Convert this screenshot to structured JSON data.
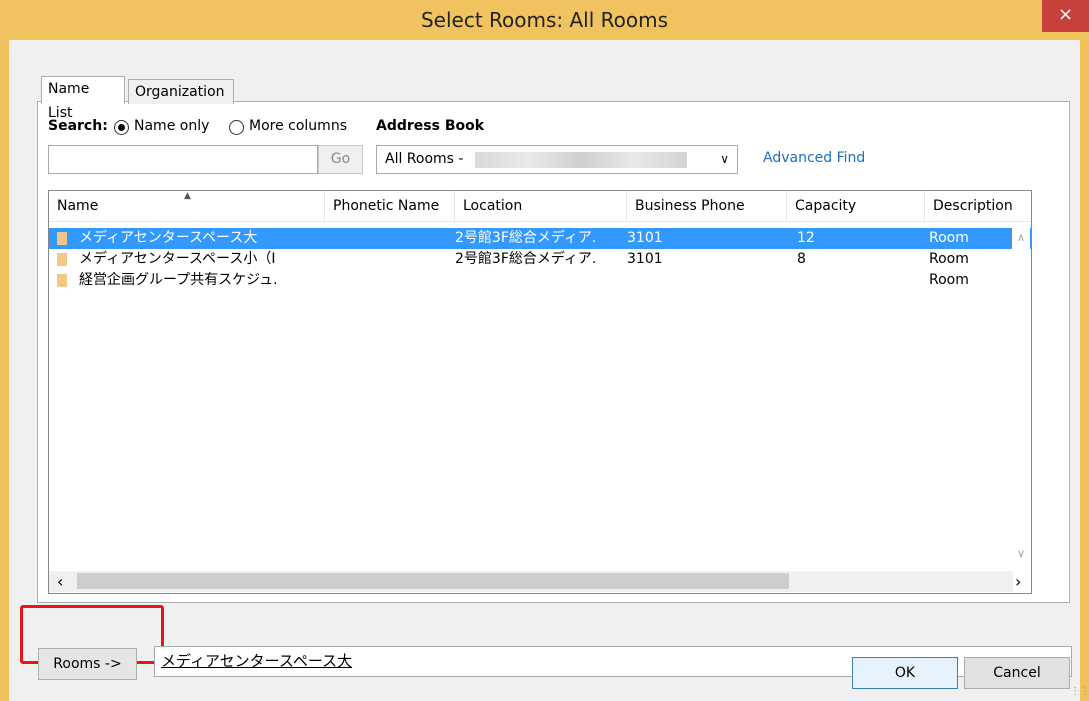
{
  "window": {
    "title": "Select Rooms: All Rooms",
    "close_icon": "×"
  },
  "tabs": [
    {
      "label": "Name List"
    },
    {
      "label": "Organization"
    }
  ],
  "search": {
    "label": "Search:",
    "options": [
      {
        "label": "Name only",
        "selected": true
      },
      {
        "label": "More columns",
        "selected": false
      }
    ],
    "input_value": "",
    "go_label": "Go"
  },
  "address_book": {
    "label": "Address Book",
    "selected": "All Rooms -",
    "advanced_find": "Advanced Find"
  },
  "list": {
    "columns": [
      "Name",
      "Phonetic Name",
      "Location",
      "Business Phone",
      "Capacity",
      "Description"
    ],
    "rows": [
      {
        "name": "メディアセンタースペース大",
        "phonetic": "",
        "location": "2号館3F総合メディア.",
        "phone": "3101",
        "capacity": "12",
        "description": "Room",
        "selected": true
      },
      {
        "name": "メディアセンタースペース小（I",
        "phonetic": "",
        "location": "2号館3F総合メディア.",
        "phone": "3101",
        "capacity": "8",
        "description": "Room",
        "selected": false
      },
      {
        "name": "経営企画グループ共有スケジュ.",
        "phonetic": "",
        "location": "",
        "phone": "",
        "capacity": "",
        "description": "Room",
        "selected": false
      }
    ]
  },
  "rooms": {
    "button_label": "Rooms ->",
    "value": "メディアセンタースペース大"
  },
  "footer": {
    "ok_label": "OK",
    "cancel_label": "Cancel"
  },
  "colors": {
    "title_bar": "#f1c35e",
    "selection": "#3399ff",
    "highlight_box": "#e8141b"
  }
}
